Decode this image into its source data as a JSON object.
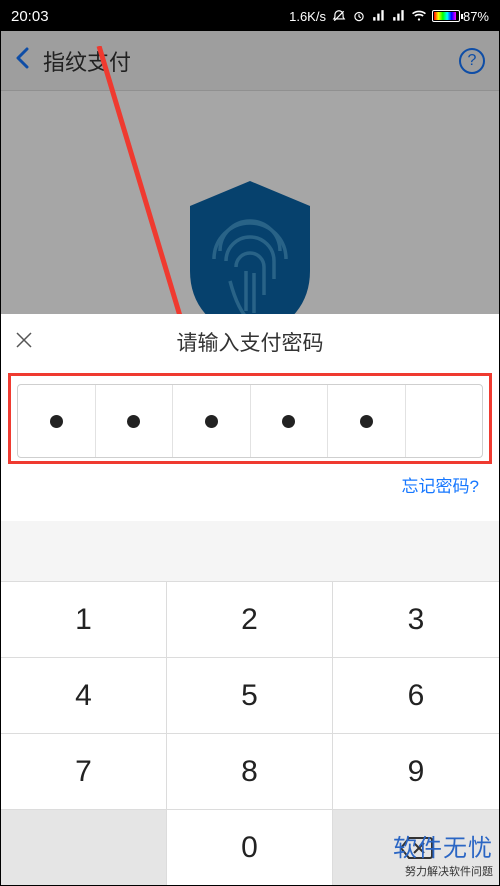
{
  "statusbar": {
    "time": "20:03",
    "speed": "1.6K/s",
    "battery_pct": "87%"
  },
  "app_header": {
    "title": "指纹支付",
    "help_label": "?"
  },
  "sheet": {
    "title": "请输入支付密码",
    "password_filled": [
      true,
      true,
      true,
      true,
      true,
      false
    ],
    "forgot_label": "忘记密码?"
  },
  "keypad": {
    "rows": [
      [
        "1",
        "2",
        "3"
      ],
      [
        "4",
        "5",
        "6"
      ],
      [
        "7",
        "8",
        "9"
      ],
      [
        "",
        "0",
        "del"
      ]
    ]
  },
  "watermark": {
    "line1": "软件无忧",
    "line2": "努力解决软件问题"
  }
}
